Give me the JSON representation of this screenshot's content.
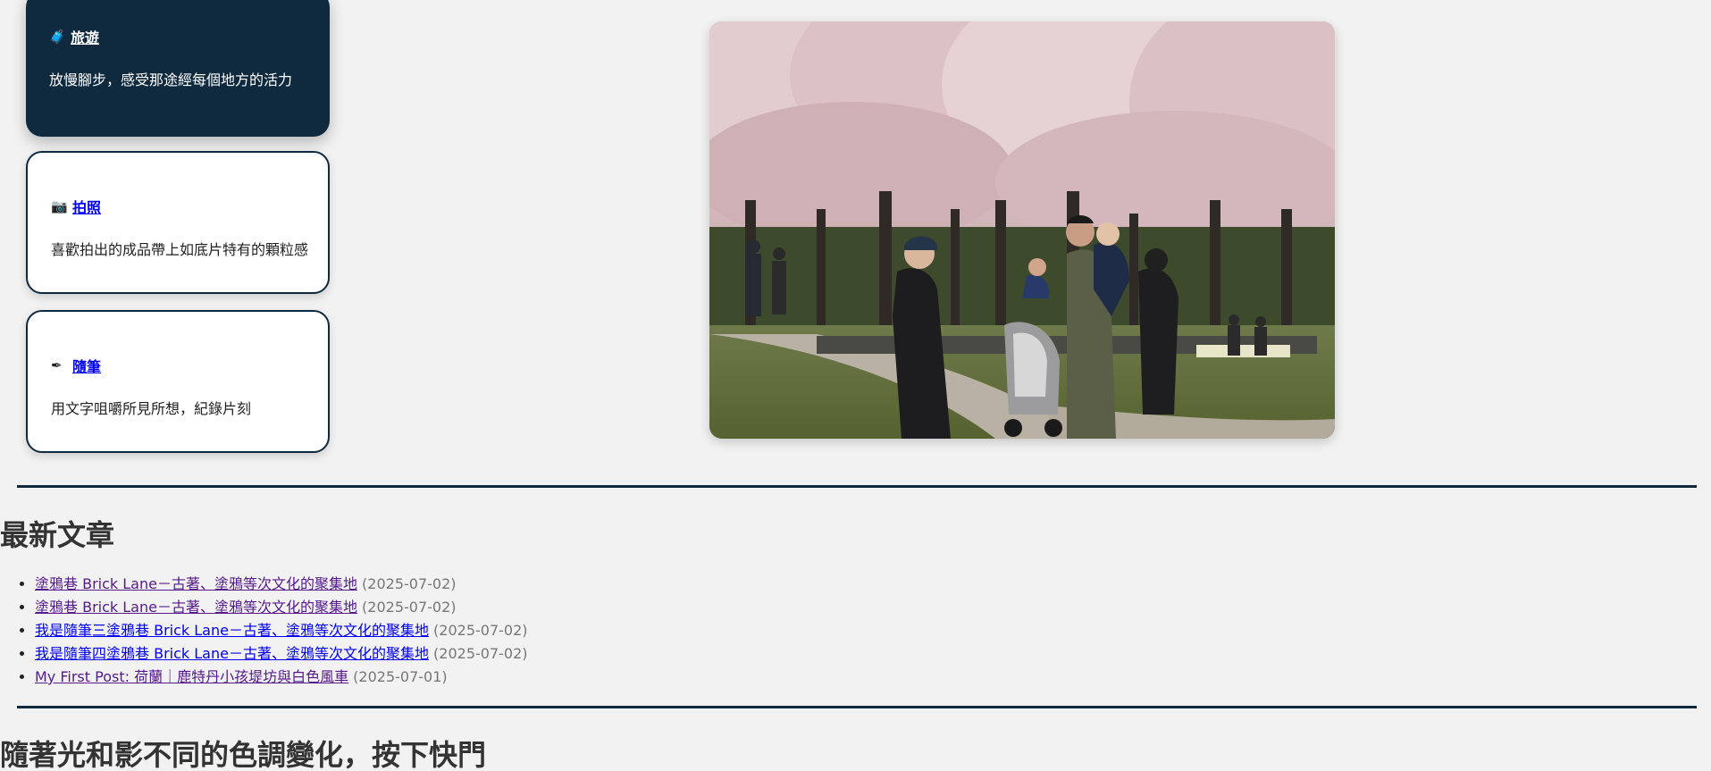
{
  "categories": [
    {
      "icon": "luggage-icon",
      "glyph": "🧳",
      "title": "旅遊",
      "description": "放慢腳步，感受那途經每個地方的活力"
    },
    {
      "icon": "camera-icon",
      "glyph": "📷",
      "title": "拍照",
      "description": "喜歡拍出的成品帶上如底片特有的顆粒感"
    },
    {
      "icon": "pen-icon",
      "glyph": "✒",
      "title": "隨筆",
      "description": "用文字咀嚼所見所想，紀錄片刻"
    }
  ],
  "latest": {
    "heading": "最新文章",
    "posts": [
      {
        "title": "塗鴉巷 Brick Lane－古著、塗鴉等次文化的聚集地",
        "date": "(2025-07-02)",
        "visited": true
      },
      {
        "title": "塗鴉巷 Brick Lane－古著、塗鴉等次文化的聚集地",
        "date": "(2025-07-02)",
        "visited": true
      },
      {
        "title": "我是隨筆三塗鴉巷 Brick Lane－古著、塗鴉等次文化的聚集地",
        "date": "(2025-07-02)",
        "visited": false
      },
      {
        "title": "我是隨筆四塗鴉巷 Brick Lane－古著、塗鴉等次文化的聚集地",
        "date": "(2025-07-02)",
        "visited": false
      },
      {
        "title": "My First Post: 荷蘭｜鹿特丹小孩堤坊與白色風車",
        "date": "(2025-07-01)",
        "visited": true
      }
    ]
  },
  "photo_section": {
    "heading": "隨著光和影不同的色調變化，按下快門"
  },
  "colors": {
    "accent_dark": "#0f2a3f",
    "link": "#0000ee",
    "visited_link": "#551a8b",
    "background": "#f2f2f2"
  }
}
